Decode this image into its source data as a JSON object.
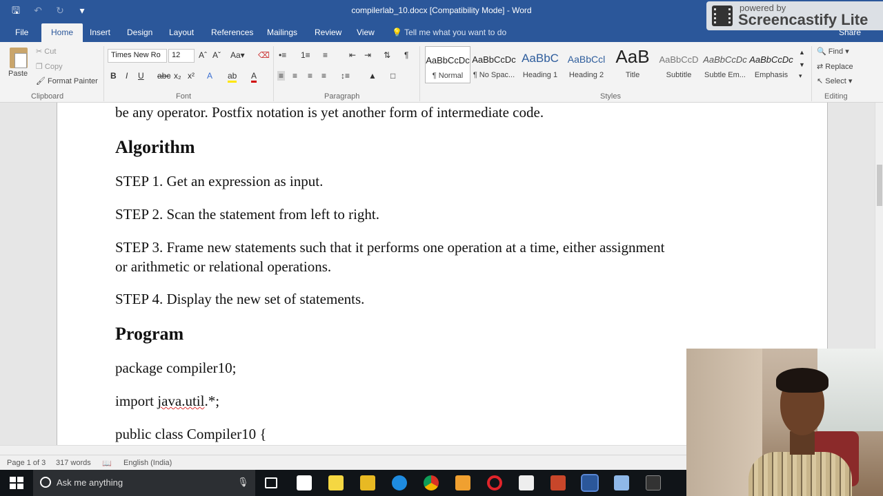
{
  "window": {
    "title": "compilerlab_10.docx [Compatibility Mode]  -  Word",
    "watermark_small": "powered by",
    "watermark_big": "Screencastify Lite"
  },
  "tabs": [
    "File",
    "Home",
    "Insert",
    "Design",
    "Layout",
    "References",
    "Mailings",
    "Review",
    "View"
  ],
  "tell_me": "Tell me what you want to do",
  "share": "Share",
  "ribbon": {
    "clipboard": {
      "paste": "Paste",
      "cut": "Cut",
      "copy": "Copy",
      "format_painter": "Format Painter",
      "label": "Clipboard"
    },
    "font": {
      "name": "Times New Ro",
      "size": "12",
      "label": "Font"
    },
    "paragraph": {
      "label": "Paragraph"
    },
    "styles": {
      "label": "Styles",
      "items": [
        {
          "preview": "AaBbCcDc",
          "name": "¶ Normal"
        },
        {
          "preview": "AaBbCcDc",
          "name": "¶ No Spac..."
        },
        {
          "preview": "AaBbC",
          "name": "Heading 1"
        },
        {
          "preview": "AaBbCcl",
          "name": "Heading 2"
        },
        {
          "preview": "AaB",
          "name": "Title"
        },
        {
          "preview": "AaBbCcD",
          "name": "Subtitle"
        },
        {
          "preview": "AaBbCcDc",
          "name": "Subtle Em..."
        },
        {
          "preview": "AaBbCcDc",
          "name": "Emphasis"
        }
      ]
    },
    "editing": {
      "find": "Find",
      "replace": "Replace",
      "select": "Select",
      "label": "Editing"
    }
  },
  "document": {
    "line1": "be any operator. Postfix notation is yet another form of intermediate code.",
    "heading_algorithm": "Algorithm",
    "step1": "STEP 1. Get an expression as input.",
    "step2": "STEP 2. Scan the statement from left to right.",
    "step3a": "STEP 3. Frame new statements such that it performs one operation at a time, either assignment",
    "step3b": "or arithmetic or relational operations.",
    "step4": "STEP 4. Display the new set of statements.",
    "heading_program": "Program",
    "code1": "package compiler10;",
    "code2_pre": "import ",
    "code2_squiggle": "java.util",
    "code2_post": ".*;",
    "code3": "public class Compiler10 {"
  },
  "status": {
    "page": "Page 1 of 3",
    "words": "317 words",
    "language": "English (India)"
  },
  "taskbar": {
    "search_placeholder": "Ask me anything"
  }
}
